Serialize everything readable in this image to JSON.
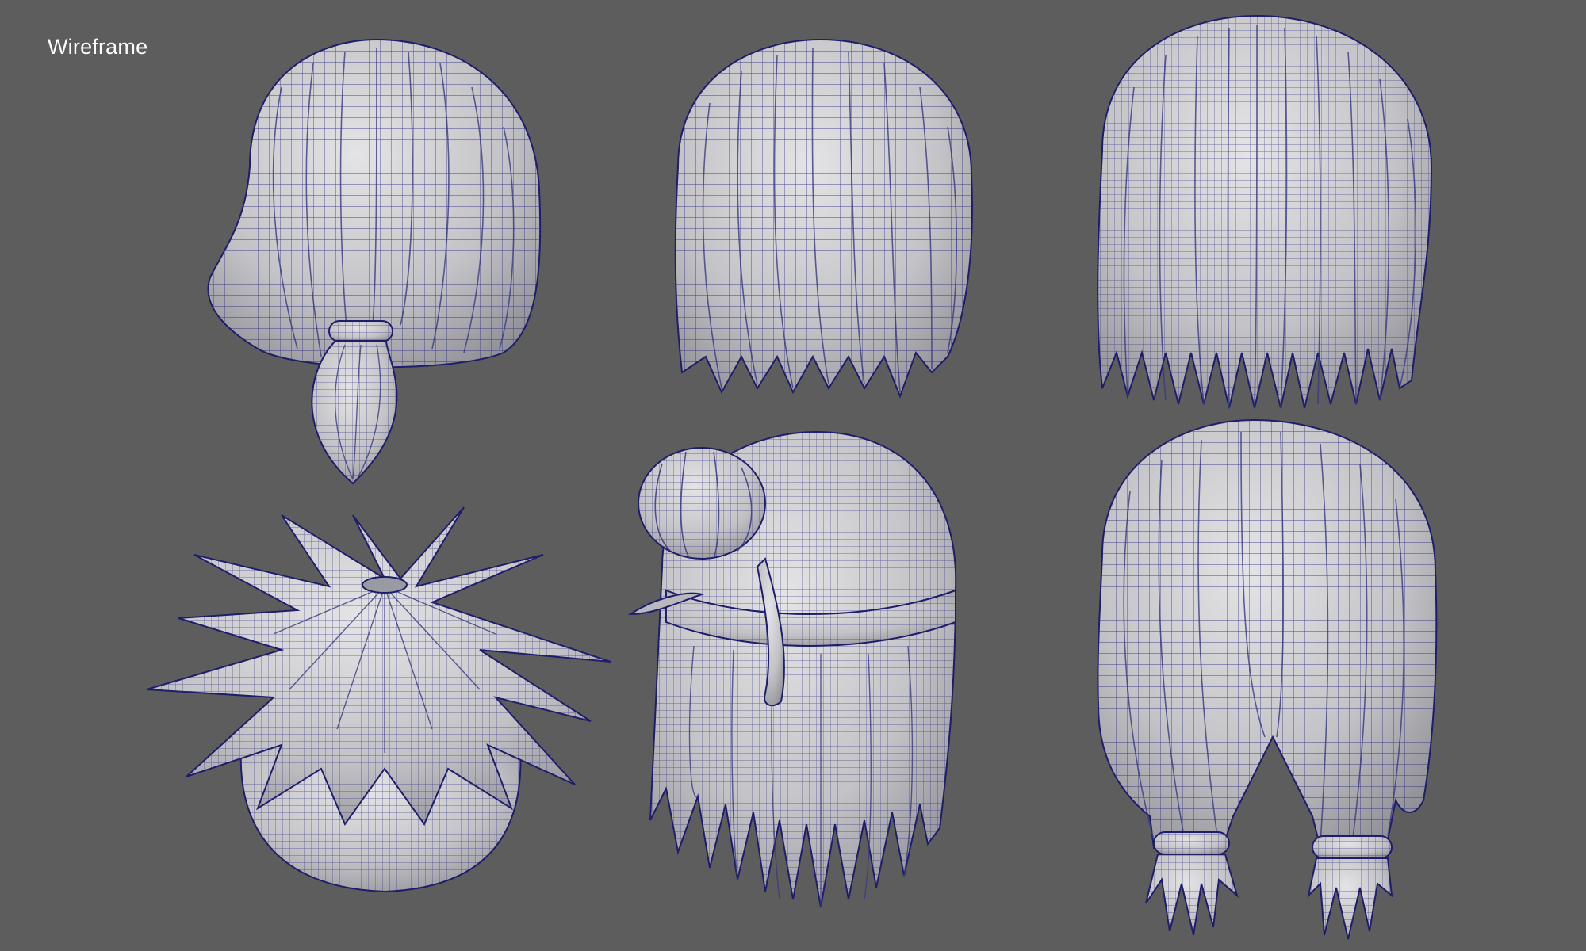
{
  "viewport": {
    "display_mode_label": "Wireframe",
    "background_color": "#5d5d5d",
    "mesh_fill_color": "#c9c9cc",
    "wire_color": "#23237a"
  },
  "models": [
    {
      "name": "hair-low-ponytail-back-view"
    },
    {
      "name": "hair-medium-straight-back-view"
    },
    {
      "name": "hair-long-straight-back-view"
    },
    {
      "name": "hair-spiky-top-view"
    },
    {
      "name": "hair-half-up-bun-back-view"
    },
    {
      "name": "hair-twin-low-tails-back-view"
    }
  ]
}
